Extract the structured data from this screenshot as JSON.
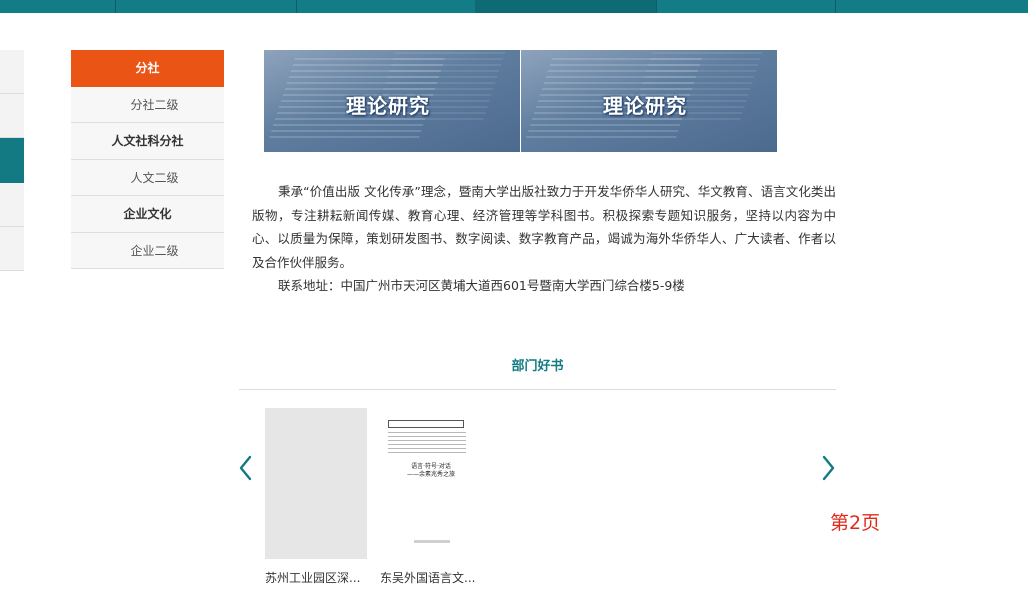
{
  "sidebar": {
    "items": [
      {
        "label": "分社"
      },
      {
        "label": "分社二级"
      },
      {
        "label": "人文社科分社"
      },
      {
        "label": "人文二级"
      },
      {
        "label": "企业文化"
      },
      {
        "label": "企业二级"
      }
    ]
  },
  "banner": {
    "left_text": "理论研究",
    "right_text": "理论研究"
  },
  "intro": {
    "paragraph": "秉承“价值出版 文化传承”理念，暨南大学出版社致力于开发华侨华人研究、华文教育、语言文化类出版物，专注耕耘新闻传媒、教育心理、经济管理等学科图书。积极探索专题知识服务，坚持以内容为中心、以质量为保障，策划研发图书、数字阅读、数字教育产品，竭诚为海外华侨华人、广大读者、作者以及合作伙伴服务。",
    "address": "联系地址：中国广州市天河区黄埔大道西601号暨南大学西门综合楼5-9楼"
  },
  "section": {
    "title": "部门好书"
  },
  "books": [
    {
      "caption": "苏州工业园区深..."
    },
    {
      "caption": "东吴外国语言文...",
      "cover_text": "语言·符号·对话\n——余素兆秀之旅"
    }
  ],
  "pager": {
    "label": "第2页"
  },
  "colors": {
    "accent_orange": "#ea5414",
    "teal": "#127d86",
    "pager_red": "#e02b1c"
  },
  "icons": {
    "prev": "chevron-left-icon",
    "next": "chevron-right-icon"
  }
}
